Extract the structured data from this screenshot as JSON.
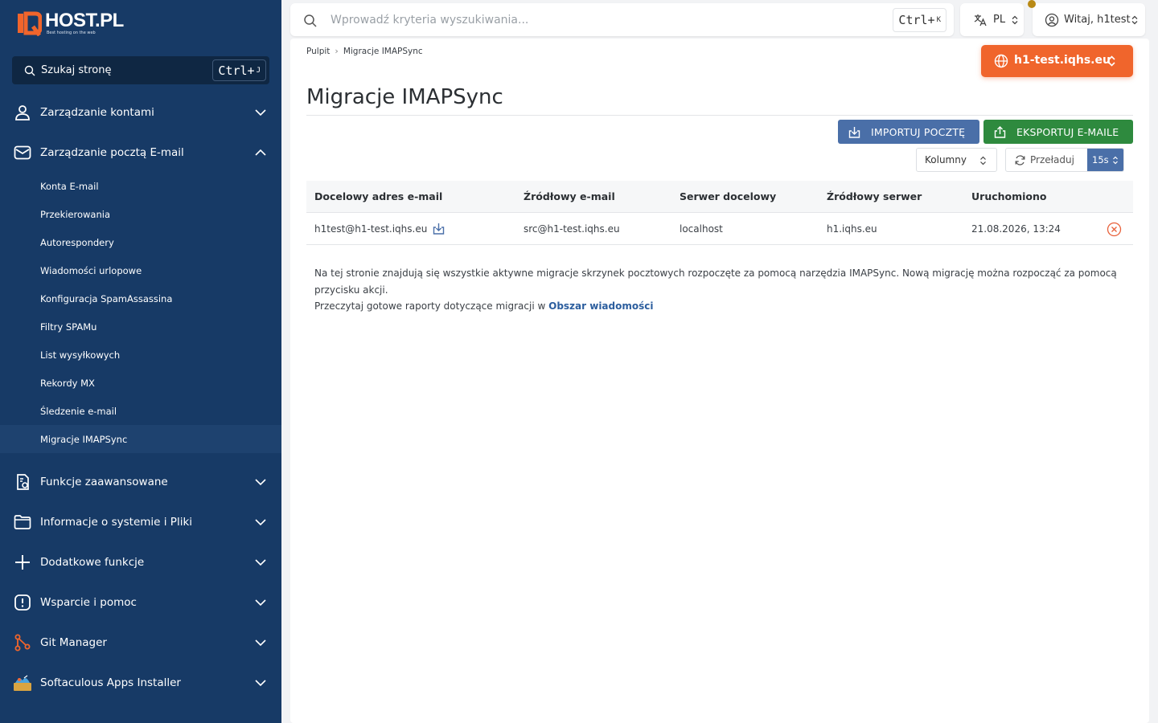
{
  "brand": {
    "name": "HOST.PL",
    "tagline": "Best hosting on the web",
    "accent": "#f0652c"
  },
  "sidebar": {
    "search_label": "Szukaj stronę",
    "search_kbd": "Ctrl+",
    "search_kbd_key": "J",
    "groups": [
      {
        "label": "Zarządzanie kontami",
        "icon": "user-icon",
        "expanded": false
      },
      {
        "label": "Zarządzanie pocztą E-mail",
        "icon": "mail-icon",
        "expanded": true
      },
      {
        "label": "Funkcje zaawansowane",
        "icon": "settings-doc-icon",
        "expanded": false
      },
      {
        "label": "Informacje o systemie i Pliki",
        "icon": "folder-icon",
        "expanded": false
      },
      {
        "label": "Dodatkowe funkcje",
        "icon": "plus-icon",
        "expanded": false
      },
      {
        "label": "Wsparcie i pomoc",
        "icon": "alert-icon",
        "expanded": false
      },
      {
        "label": "Git Manager",
        "icon": "git-icon",
        "expanded": false
      },
      {
        "label": "Softaculous Apps Installer",
        "icon": "softaculous-icon",
        "expanded": false
      }
    ],
    "mail_items": [
      {
        "label": "Konta E-mail"
      },
      {
        "label": "Przekierowania"
      },
      {
        "label": "Autorespondery"
      },
      {
        "label": "Wiadomości urlopowe"
      },
      {
        "label": "Konfiguracja SpamAssassina"
      },
      {
        "label": "Filtry SPAMu"
      },
      {
        "label": "List wysyłkowych"
      },
      {
        "label": "Rekordy MX"
      },
      {
        "label": "Śledzenie e-mail"
      },
      {
        "label": "Migracje IMAPSync",
        "active": true
      }
    ]
  },
  "topbar": {
    "search_placeholder": "Wprowadź kryteria wyszukiwania...",
    "search_kbd": "Ctrl+",
    "search_kbd_key": "K",
    "language": "PL",
    "user_greeting": "Witaj, h1test"
  },
  "breadcrumb": {
    "home": "Pulpit",
    "current": "Migracje IMAPSync"
  },
  "domain_selector": "h1-test.iqhs.eu",
  "page_title": "Migracje IMAPSync",
  "actions": {
    "import_label": "IMPORTUJ POCZTĘ",
    "export_label": "EKSPORTUJ E-MAILE",
    "columns_label": "Kolumny",
    "reload_label": "Przeładuj",
    "reload_interval": "15s"
  },
  "table": {
    "headers": [
      "Docelowy adres e-mail",
      "Źródłowy e-mail",
      "Serwer docelowy",
      "Źródłowy serwer",
      "Uruchomiono"
    ],
    "rows": [
      {
        "target_email": "h1test@h1-test.iqhs.eu",
        "source_email": "src@h1-test.iqhs.eu",
        "target_server": "localhost",
        "source_server": "h1.iqhs.eu",
        "started": "21.08.2026, 13:24"
      }
    ]
  },
  "info": {
    "line1": "Na tej stronie znajdują się wszystkie aktywne migracje skrzynek pocztowych rozpoczęte za pomocą narzędzia IMAPSync. Nową migrację można rozpocząć za pomocą przycisku akcji.",
    "line2_prefix": "Przeczytaj gotowe raporty dotyczące migracji w ",
    "line2_link": "Obszar wiadomości"
  },
  "colors": {
    "sidebar_bg": "#173a66",
    "import_btn": "#4a6fa8",
    "export_btn": "#2e8a3e",
    "cancel_icon": "#e8603a"
  }
}
